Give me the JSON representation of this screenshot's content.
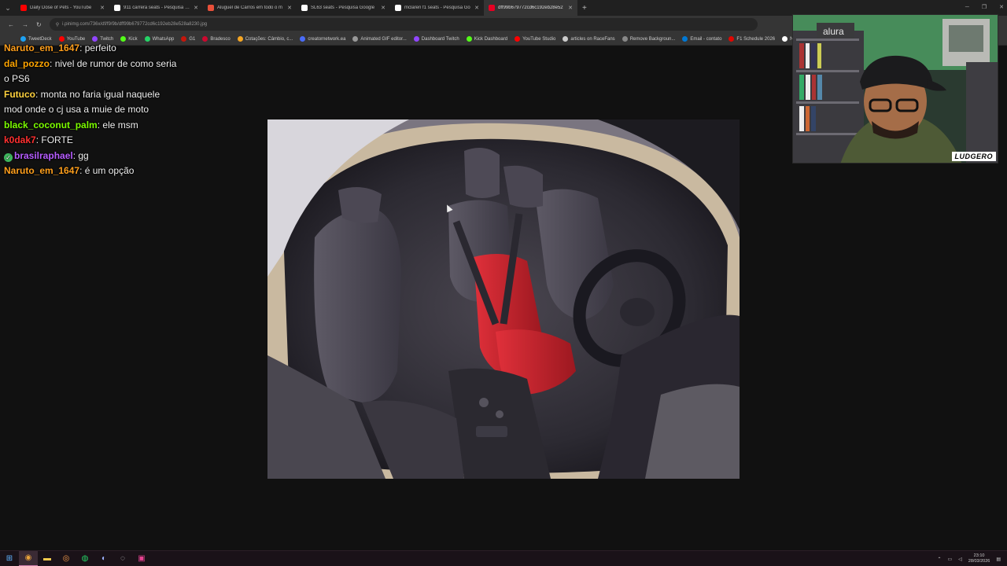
{
  "browser": {
    "tabs": [
      {
        "title": "Daily Dose of Pets - YouTube",
        "color": "#ff0000"
      },
      {
        "title": "911 carrera seats - Pesquisa Go",
        "color": "#ffffff"
      },
      {
        "title": "Aluguel de Carros em todo o m",
        "color": "#e8503a"
      },
      {
        "title": "SL63 seats - Pesquisa Google",
        "color": "#ffffff"
      },
      {
        "title": "mclaren f1 seats - Pesquisa Go",
        "color": "#ffffff"
      },
      {
        "title": "dff99b679772cd6c192eb28e52",
        "color": "#e60023",
        "active": true
      }
    ],
    "url": "i.pinimg.com/736x/df/f9/9b/dff99b679772cd6c192eb28e528a8230.jpg",
    "bookmarks": [
      {
        "label": "TweetDeck",
        "color": "#1da1f2"
      },
      {
        "label": "YouTube",
        "color": "#ff0000"
      },
      {
        "label": "Twitch",
        "color": "#9146ff"
      },
      {
        "label": "Kick",
        "color": "#53fc18"
      },
      {
        "label": "WhatsApp",
        "color": "#25d366"
      },
      {
        "label": "G1",
        "color": "#c4170c"
      },
      {
        "label": "Bradesco",
        "color": "#cc092f"
      },
      {
        "label": "Cotações: Câmbio, c...",
        "color": "#f5a623"
      },
      {
        "label": "creatornetwork.ea",
        "color": "#4a6cf7"
      },
      {
        "label": "Animated GIF editor...",
        "color": "#999999"
      },
      {
        "label": "Dashboard Twitch",
        "color": "#9146ff"
      },
      {
        "label": "Kick Dashboard",
        "color": "#53fc18"
      },
      {
        "label": "YouTube Studio",
        "color": "#ff0000"
      },
      {
        "label": "articles on RaceFans",
        "color": "#cccccc"
      },
      {
        "label": "Remove Backgroun...",
        "color": "#888888"
      },
      {
        "label": "Email - contato",
        "color": "#0078d4"
      },
      {
        "label": "F1 Schedule 2026",
        "color": "#e10600"
      },
      {
        "label": "Not",
        "color": "#ffffff"
      }
    ]
  },
  "chat": {
    "messages": [
      {
        "user": "Naruto_em_1647",
        "color": "#ff9f1c",
        "text": "perfeito"
      },
      {
        "user": "dal_pozzo",
        "color": "#ffa500",
        "text": "nivel de rumor de como seria o PS6"
      },
      {
        "user": "Futuco",
        "color": "#ffd23f",
        "text": "monta no faria igual naquele mod onde o cj usa a muie de moto"
      },
      {
        "user": "black_coconut_palm",
        "color": "#7cfc00",
        "text": "ele msm"
      },
      {
        "user": "k0dak7",
        "color": "#ff3030",
        "text": "FORTE"
      },
      {
        "user": "brasilraphael",
        "color": "#b65cff",
        "text": "gg",
        "badge": true
      },
      {
        "user": "Naruto_em_1647",
        "color": "#ff9f1c",
        "text": "é um opção"
      }
    ]
  },
  "webcam": {
    "logo": "LUDGERO",
    "wall_sign": "alura"
  },
  "taskbar": {
    "clock_time": "23:10",
    "clock_date": "28/03/2026"
  },
  "colors": {
    "page_bg": "#111111",
    "seat_accent": "#c8202a"
  }
}
